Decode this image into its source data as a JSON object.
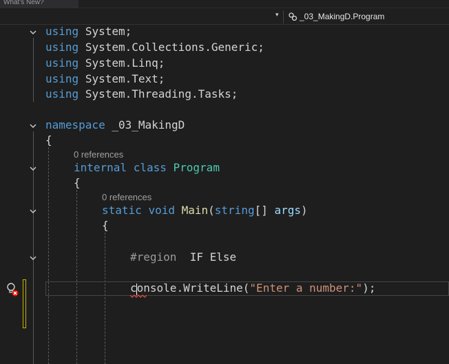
{
  "tabs": {
    "active_label": "What's New?"
  },
  "navbar": {
    "member_label": "_03_MakingD.Program"
  },
  "lenses": {
    "class_refs": "0 references",
    "method_refs": "0 references"
  },
  "code": {
    "using1_kw": "using",
    "using1_ns": "System;",
    "using2_kw": "using",
    "using2_a": "System",
    "using2_b": "Collections",
    "using2_c": "Generic;",
    "using3_kw": "using",
    "using3_a": "System",
    "using3_b": "Linq;",
    "using4_kw": "using",
    "using4_a": "System",
    "using4_b": "Text;",
    "using5_kw": "using",
    "using5_a": "System",
    "using5_b": "Threading",
    "using5_c": "Tasks;",
    "ns_kw": "namespace",
    "ns_name": "_03_MakingD",
    "brace_open": "{",
    "class_mod": "internal",
    "class_kw": "class",
    "class_name": "Program",
    "method_static": "static",
    "method_void": "void",
    "method_name": "Main",
    "param_type": "string",
    "param_brackets": "[]",
    "param_name": "args",
    "paren_open": "(",
    "paren_close": ")",
    "region_kw": "#region",
    "region_name": "IF Else",
    "stmt_obj": "console",
    "stmt_method": "WriteLine",
    "stmt_str": "\"Enter a number:\"",
    "stmt_end": ");"
  },
  "icons": {
    "fold": "chevron-down-icon",
    "bulb": "lightbulb-icon",
    "member": "class-member-icon"
  },
  "colors": {
    "background": "#1e1e1e",
    "keyword": "#569cd6",
    "type": "#4ec9b0",
    "method": "#dcdcaa",
    "parameter": "#9cdcfe",
    "string": "#ce9178",
    "change_bar": "#c9b600",
    "squiggle": "#f14c4c"
  }
}
